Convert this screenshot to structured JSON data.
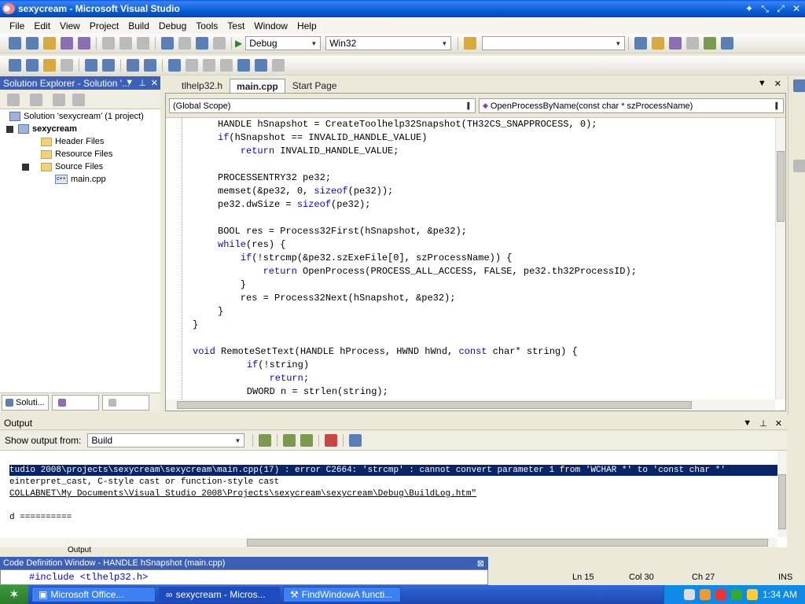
{
  "window": {
    "title": "sexycream - Microsoft Visual Studio"
  },
  "menu": [
    "File",
    "Edit",
    "View",
    "Project",
    "Build",
    "Debug",
    "Tools",
    "Test",
    "Window",
    "Help"
  ],
  "toolbar": {
    "config": "Debug",
    "platform": "Win32"
  },
  "solution_explorer": {
    "title": "Solution Explorer - Solution '...",
    "solution": "Solution 'sexycream' (1 project)",
    "project": "sexycream",
    "folders": [
      "Header Files",
      "Resource Files",
      "Source Files"
    ],
    "file": "main.cpp",
    "tab_label": "Soluti..."
  },
  "doc_tabs": [
    "tlhelp32.h",
    "main.cpp",
    "Start Page"
  ],
  "nav": {
    "scope": "(Global Scope)",
    "member": "OpenProcessByName(const char * szProcessName)"
  },
  "code_lines": [
    "HANDLE hSnapshot = CreateToolhelp32Snapshot(TH32CS_SNAPPROCESS, 0);",
    "if(hSnapshot == INVALID_HANDLE_VALUE)",
    "    return INVALID_HANDLE_VALUE;",
    "",
    "PROCESSENTRY32 pe32;",
    "memset(&pe32, 0, sizeof(pe32));",
    "pe32.dwSize = sizeof(pe32);",
    "",
    "BOOL res = Process32First(hSnapshot, &pe32);",
    "while(res) {",
    "    if(!strcmp(&pe32.szExeFile[0], szProcessName)) {",
    "        return OpenProcess(PROCESS_ALL_ACCESS, FALSE, pe32.th32ProcessID);",
    "    }",
    "    res = Process32Next(hSnapshot, &pe32);",
    "}",
    "}",
    "",
    "void RemoteSetText(HANDLE hProcess, HWND hWnd, const char* string) {",
    "    if(!string)",
    "        return;",
    "    DWORD n = strlen(string);"
  ],
  "output": {
    "title": "Output",
    "show_from_label": "Show output from:",
    "source": "Build",
    "lines": [
      "tudio 2008\\projects\\sexycream\\sexycream\\main.cpp(17) : error C2664: 'strcmp' : cannot convert parameter 1 from 'WCHAR *' to 'const char *'",
      "einterpret_cast, C-style cast or function-style cast",
      "COLLABNET\\My Documents\\Visual Studio 2008\\Projects\\sexycream\\sexycream\\Debug\\BuildLog.htm\"",
      "",
      "d =========="
    ],
    "tab_label": "Output"
  },
  "code_def": {
    "title": "Code Definition Window - HANDLE hSnapshot (main.cpp)",
    "line": "#include <tlhelp32.h>"
  },
  "status": {
    "ln": "Ln 15",
    "col": "Col 30",
    "ch": "Ch 27",
    "mode": "INS"
  },
  "taskbar": {
    "tasks": [
      "Microsoft Office...",
      "sexycream - Micros...",
      "FindWindowA functi..."
    ],
    "clock": "1:34 AM"
  }
}
